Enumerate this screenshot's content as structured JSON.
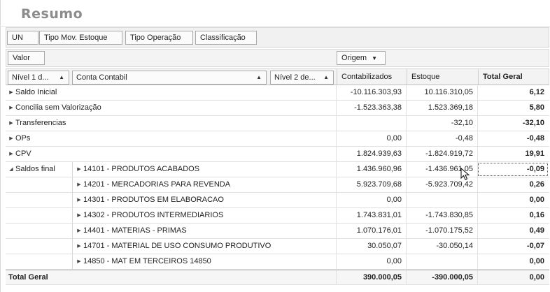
{
  "title": "Resumo",
  "filters": [
    "UN",
    "Tipo Mov. Estoque",
    "Tipo Operação",
    "Classificação"
  ],
  "data_field": "Valor",
  "column_field": "Origem",
  "row_fields": [
    "Nível 1 d...",
    "Conta Contabil",
    "Nível 2 de..."
  ],
  "columns": [
    "Contabilizados",
    "Estoque",
    "Total Geral"
  ],
  "rows": [
    {
      "label": "Saldo Inicial",
      "contabilizados": "-10.116.303,93",
      "estoque": "10.116.310,05",
      "total": "6,12"
    },
    {
      "label": "Concilia sem Valorização",
      "contabilizados": "-1.523.363,38",
      "estoque": "1.523.369,18",
      "total": "5,80"
    },
    {
      "label": "Transferencias",
      "contabilizados": "",
      "estoque": "-32,10",
      "total": "-32,10"
    },
    {
      "label": "OPs",
      "contabilizados": "0,00",
      "estoque": "-0,48",
      "total": "-0,48"
    },
    {
      "label": "CPV",
      "contabilizados": "1.824.939,63",
      "estoque": "-1.824.919,72",
      "total": "19,91"
    }
  ],
  "group": {
    "label": "Saldos final",
    "children": [
      {
        "label": "14101 - PRODUTOS ACABADOS",
        "contabilizados": "1.436.960,96",
        "estoque": "-1.436.961,05",
        "total": "-0,09"
      },
      {
        "label": "14201 - MERCADORIAS PARA REVENDA",
        "contabilizados": "5.923.709,68",
        "estoque": "-5.923.709,42",
        "total": "0,26"
      },
      {
        "label": "14301 - PRODUTOS EM ELABORACAO",
        "contabilizados": "0,00",
        "estoque": "",
        "total": "0,00"
      },
      {
        "label": "14302 - PRODUTOS INTERMEDIARIOS",
        "contabilizados": "1.743.831,01",
        "estoque": "-1.743.830,85",
        "total": "0,16"
      },
      {
        "label": "14401 - MATERIAS - PRIMAS",
        "contabilizados": "1.070.176,01",
        "estoque": "-1.070.175,52",
        "total": "0,49"
      },
      {
        "label": "14701 - MATERIAL DE USO CONSUMO PRODUTIVO",
        "contabilizados": "30.050,07",
        "estoque": "-30.050,14",
        "total": "-0,07"
      },
      {
        "label": "14850 - MAT EM TERCEIROS 14850",
        "contabilizados": "0,00",
        "estoque": "",
        "total": "0,00"
      }
    ]
  },
  "grand_total": {
    "label": "Total Geral",
    "contabilizados": "390.000,05",
    "estoque": "-390.000,05",
    "total": "0,00"
  }
}
